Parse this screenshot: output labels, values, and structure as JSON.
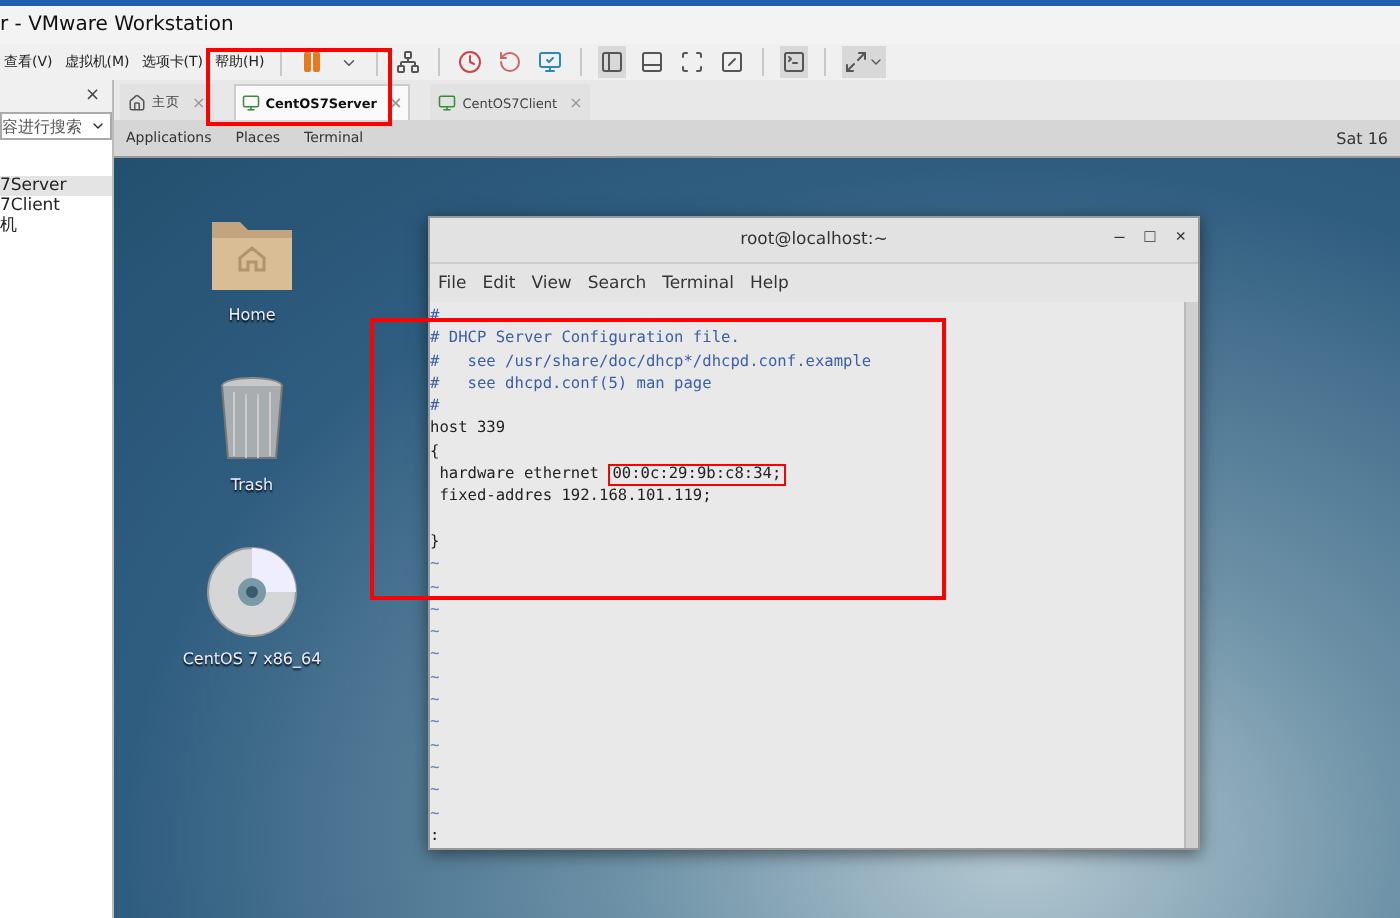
{
  "window": {
    "title": "r - VMware Workstation"
  },
  "menu": [
    "查看(V)",
    "虚拟机(M)",
    "选项卡(T)",
    "帮助(H)"
  ],
  "library": {
    "close": "×",
    "search": {
      "placeholder": "容进行搜索"
    },
    "items": [
      {
        "label": "7Server",
        "selected": true
      },
      {
        "label": "7Client",
        "selected": false
      },
      {
        "label": "机",
        "selected": false
      }
    ]
  },
  "tabs": [
    {
      "kind": "home",
      "label": "主页",
      "selected": false,
      "close": "×"
    },
    {
      "kind": "vm",
      "label": "CentOS7Server",
      "selected": true,
      "close": "×"
    },
    {
      "kind": "vm",
      "label": "CentOS7Client",
      "selected": false,
      "close": "×"
    }
  ],
  "guest": {
    "topbar": {
      "menus": [
        "Applications",
        "Places",
        "Terminal"
      ],
      "clock": "Sat 16"
    },
    "desktop_icons": [
      {
        "kind": "folder",
        "label": "Home"
      },
      {
        "kind": "trash",
        "label": "Trash"
      },
      {
        "kind": "disc",
        "label": "CentOS 7 x86_64"
      }
    ],
    "terminal": {
      "title": "root@localhost:~",
      "controls": [
        "–",
        "□",
        "×"
      ],
      "menu": [
        "File",
        "Edit",
        "View",
        "Search",
        "Terminal",
        "Help"
      ],
      "lines": [
        {
          "kind": "comment",
          "text": "#"
        },
        {
          "kind": "comment",
          "text": "# DHCP Server Configuration file."
        },
        {
          "kind": "comment",
          "text": "#   see /usr/share/doc/dhcp*/dhcpd.conf.example"
        },
        {
          "kind": "comment",
          "text": "#   see dhcpd.conf(5) man page"
        },
        {
          "kind": "comment",
          "text": "#"
        },
        {
          "kind": "code",
          "text": "host 339"
        },
        {
          "kind": "code",
          "text": "{"
        },
        {
          "kind": "code",
          "text": " hardware ethernet ",
          "marked": "00:0c:29:9b:c8:34;"
        },
        {
          "kind": "code",
          "text": " fixed-addres 192.168.101.119;"
        },
        {
          "kind": "blank"
        },
        {
          "kind": "code",
          "text": "}"
        },
        {
          "kind": "tilde",
          "text": "~"
        },
        {
          "kind": "tilde",
          "text": "~"
        },
        {
          "kind": "tilde",
          "text": "~"
        },
        {
          "kind": "tilde",
          "text": "~"
        },
        {
          "kind": "tilde",
          "text": "~"
        },
        {
          "kind": "tilde",
          "text": "~"
        },
        {
          "kind": "tilde",
          "text": "~"
        },
        {
          "kind": "tilde",
          "text": "~"
        },
        {
          "kind": "tilde",
          "text": "~"
        },
        {
          "kind": "tilde",
          "text": "~"
        },
        {
          "kind": "tilde",
          "text": "~"
        },
        {
          "kind": "tilde",
          "text": "~"
        },
        {
          "kind": "code",
          "text": ":"
        }
      ]
    }
  },
  "annotations": {
    "toolbar_box": true,
    "content_box": true
  }
}
